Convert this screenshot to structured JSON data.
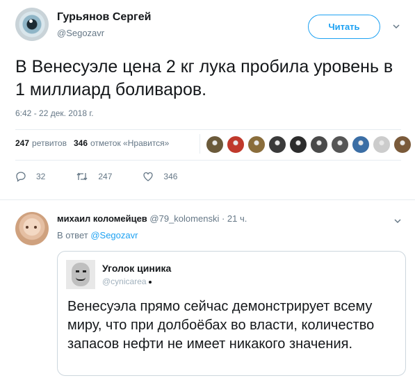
{
  "tweet": {
    "author_name": "Гурьянов Сергей",
    "author_handle": "@Segozavr",
    "follow_label": "Читать",
    "text": "В Венесуэле цена 2 кг лука пробила уровень в 1 миллиард боливаров.",
    "timestamp": "6:42 - 22 дек. 2018 г.",
    "retweets_count": "247",
    "retweets_label": "ретвитов",
    "likes_count": "346",
    "likes_label": "отметок «Нравится»",
    "liker_colors": [
      "#6b5a3a",
      "#c0392b",
      "#8a6d3b",
      "#3a3a3a",
      "#2c2c2c",
      "#4a4a4a",
      "#555555",
      "#3b6ea5",
      "#cccccc",
      "#7a5a3a"
    ],
    "actions": {
      "reply_count": "32",
      "retweet_count": "247",
      "like_count": "346"
    }
  },
  "reply": {
    "author_name": "михаил коломейцев",
    "author_handle": "@79_kolomenski",
    "time_ago": "· 21 ч.",
    "reply_to_prefix": "В ответ",
    "reply_to_mention": "@Segozavr",
    "quote": {
      "name": "Уголок циника",
      "handle": "@cynicarea",
      "text": "Венесуэла прямо сейчас демонстрирует всему миру, что при долбоёбах во власти, количество запасов нефти не имеет никакого значения."
    }
  },
  "colors": {
    "accent": "#1da1f2",
    "muted": "#657786",
    "text": "#14171a",
    "border": "#e6ecf0"
  }
}
